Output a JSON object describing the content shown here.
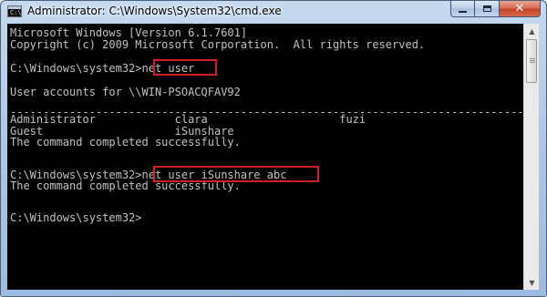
{
  "window": {
    "title": "Administrator: C:\\Windows\\System32\\cmd.exe",
    "icon": "cmd-icon",
    "buttons": {
      "minimize": "minimize-icon",
      "maximize": "maximize-icon",
      "close": "✕"
    }
  },
  "console": {
    "lines": [
      "Microsoft Windows [Version 6.1.7601]",
      "Copyright (c) 2009 Microsoft Corporation.  All rights reserved.",
      "",
      "C:\\Windows\\system32>net user",
      "",
      "User accounts for \\\\WIN-PSOACQFAV92",
      "",
      "-------------------------------------------------------------------------------",
      "Administrator            clara                    fuzi",
      "Guest                    iSunshare",
      "The command completed successfully.",
      "",
      "",
      "C:\\Windows\\system32>net user iSunshare abc",
      "The command completed successfully.",
      "",
      "",
      "C:\\Windows\\system32>"
    ],
    "text_color": "#c0c0c0",
    "background": "#000000",
    "highlight_color": "#d0202a",
    "highlights": [
      "net user",
      "net user iSunshare abc"
    ]
  }
}
